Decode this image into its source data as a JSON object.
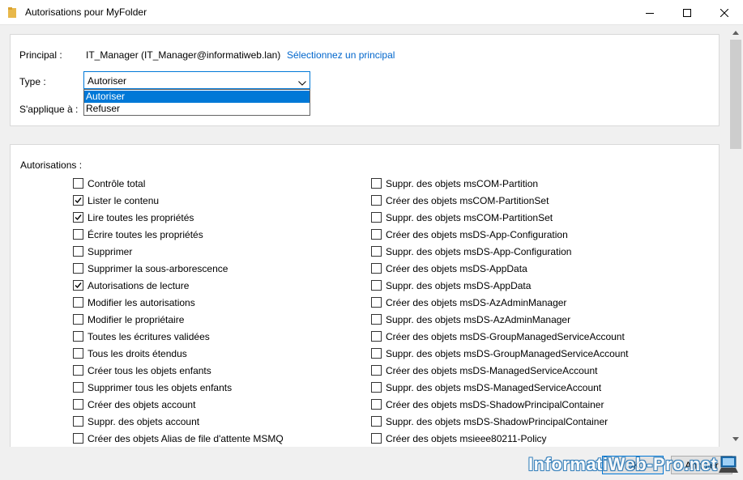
{
  "window": {
    "title": "Autorisations pour MyFolder"
  },
  "principal": {
    "label": "Principal :",
    "value": "IT_Manager (IT_Manager@informatiweb.lan)",
    "link": "Sélectionnez un principal"
  },
  "type": {
    "label": "Type :",
    "selected": "Autoriser",
    "options": [
      "Autoriser",
      "Refuser"
    ]
  },
  "applies": {
    "label": "S'applique à :"
  },
  "permissions": {
    "title": "Autorisations :",
    "left": [
      {
        "label": "Contrôle total",
        "checked": false
      },
      {
        "label": "Lister le contenu",
        "checked": true
      },
      {
        "label": "Lire toutes les propriétés",
        "checked": true
      },
      {
        "label": "Écrire toutes les propriétés",
        "checked": false
      },
      {
        "label": "Supprimer",
        "checked": false
      },
      {
        "label": "Supprimer la sous-arborescence",
        "checked": false
      },
      {
        "label": "Autorisations de lecture",
        "checked": true
      },
      {
        "label": "Modifier les autorisations",
        "checked": false
      },
      {
        "label": "Modifier le propriétaire",
        "checked": false
      },
      {
        "label": "Toutes les écritures validées",
        "checked": false
      },
      {
        "label": "Tous les droits étendus",
        "checked": false
      },
      {
        "label": "Créer tous les objets enfants",
        "checked": false
      },
      {
        "label": "Supprimer tous les objets enfants",
        "checked": false
      },
      {
        "label": "Créer des objets account",
        "checked": false
      },
      {
        "label": "Suppr. des objets account",
        "checked": false
      },
      {
        "label": "Créer des objets Alias de file d'attente MSMQ",
        "checked": false
      }
    ],
    "right": [
      {
        "label": "Suppr. des objets msCOM-Partition",
        "checked": false
      },
      {
        "label": "Créer des objets msCOM-PartitionSet",
        "checked": false
      },
      {
        "label": "Suppr. des objets msCOM-PartitionSet",
        "checked": false
      },
      {
        "label": "Créer des objets msDS-App-Configuration",
        "checked": false
      },
      {
        "label": "Suppr. des objets msDS-App-Configuration",
        "checked": false
      },
      {
        "label": "Créer des objets msDS-AppData",
        "checked": false
      },
      {
        "label": "Suppr. des objets msDS-AppData",
        "checked": false
      },
      {
        "label": "Créer des objets msDS-AzAdminManager",
        "checked": false
      },
      {
        "label": "Suppr. des objets msDS-AzAdminManager",
        "checked": false
      },
      {
        "label": "Créer des objets msDS-GroupManagedServiceAccount",
        "checked": false
      },
      {
        "label": "Suppr. des objets msDS-GroupManagedServiceAccount",
        "checked": false
      },
      {
        "label": "Créer des objets msDS-ManagedServiceAccount",
        "checked": false
      },
      {
        "label": "Suppr. des objets msDS-ManagedServiceAccount",
        "checked": false
      },
      {
        "label": "Créer des objets msDS-ShadowPrincipalContainer",
        "checked": false
      },
      {
        "label": "Suppr. des objets msDS-ShadowPrincipalContainer",
        "checked": false
      },
      {
        "label": "Créer des objets msieee80211-Policy",
        "checked": false
      }
    ]
  },
  "buttons": {
    "ok": "OK",
    "cancel": "Annuler"
  },
  "watermark": "InformatiWeb-Pro.net",
  "colors": {
    "accent": "#0078d7",
    "link": "#0066cc",
    "folder": "#e8b84a"
  }
}
